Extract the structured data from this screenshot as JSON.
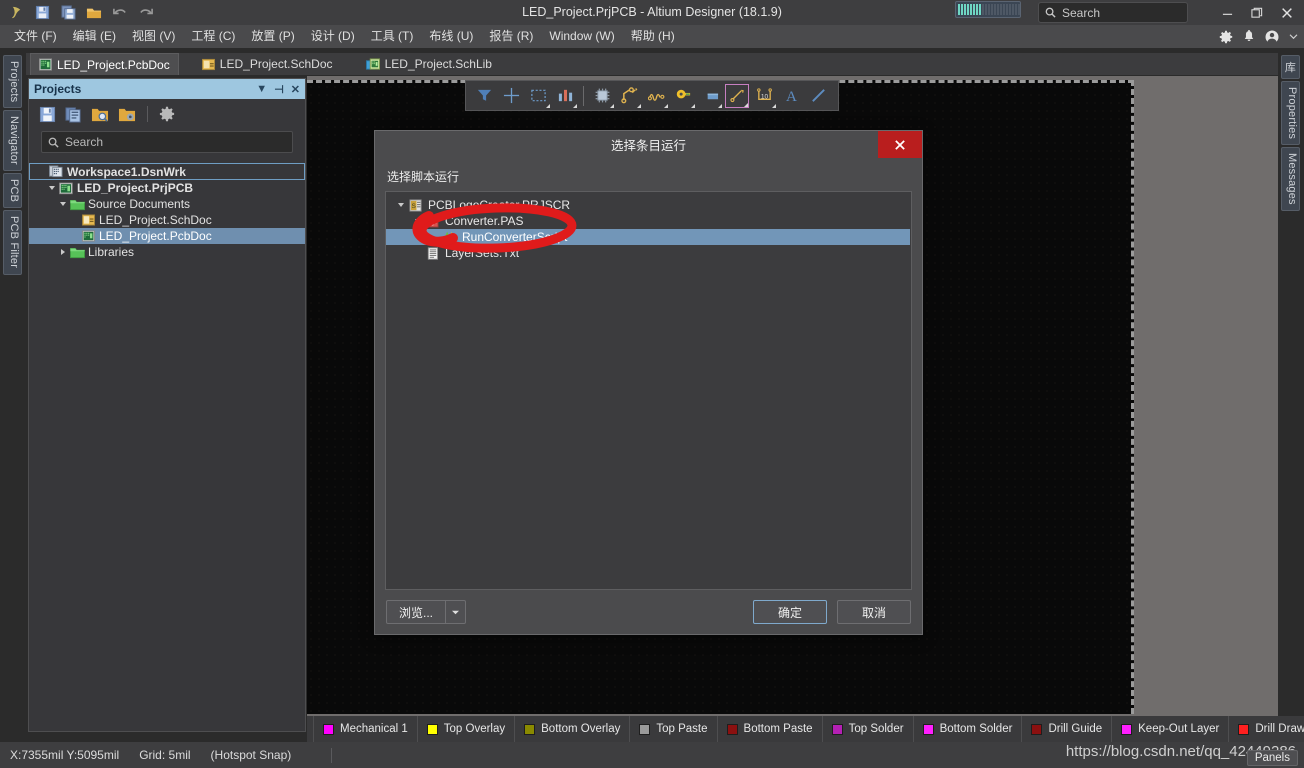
{
  "window": {
    "title": "LED_Project.PrjPCB - Altium Designer (18.1.9)",
    "minimize": "–",
    "restore": "❐",
    "close": "✕"
  },
  "quick_access": [
    {
      "name": "altium-logo-icon",
      "label": "A"
    },
    {
      "name": "save-icon",
      "label": "Save"
    },
    {
      "name": "save-all-icon",
      "label": "Save All"
    },
    {
      "name": "open-folder-icon",
      "label": "Open"
    },
    {
      "name": "undo-icon",
      "label": "Undo"
    },
    {
      "name": "redo-icon",
      "label": "Redo"
    }
  ],
  "level_widget": {
    "name": "license-level-indicator",
    "filled": 8,
    "total": 22
  },
  "search": {
    "placeholder": "Search",
    "value": "Search",
    "icon": "search-icon"
  },
  "menu": [
    {
      "label": "文件 (F)"
    },
    {
      "label": "编辑 (E)"
    },
    {
      "label": "视图 (V)"
    },
    {
      "label": "工程 (C)"
    },
    {
      "label": "放置 (P)"
    },
    {
      "label": "设计 (D)"
    },
    {
      "label": "工具 (T)"
    },
    {
      "label": "布线 (U)"
    },
    {
      "label": "报告 (R)"
    },
    {
      "label": "Window (W)"
    },
    {
      "label": "帮助 (H)"
    }
  ],
  "menu_right_icons": [
    {
      "name": "gear-icon"
    },
    {
      "name": "bell-icon"
    },
    {
      "name": "user-account-icon"
    },
    {
      "name": "chevron-down-icon"
    }
  ],
  "doc_tabs": [
    {
      "label": "LED_Project.PcbDoc",
      "icon": "pcb-document-icon",
      "active": true
    },
    {
      "label": "LED_Project.SchDoc",
      "icon": "schematic-document-icon",
      "active": false
    },
    {
      "label": "LED_Project.SchLib",
      "icon": "schematic-library-icon",
      "active": false
    }
  ],
  "left_rail": [
    {
      "label": "Projects",
      "active": true
    },
    {
      "label": "Navigator",
      "active": false
    },
    {
      "label": "PCB",
      "active": false
    },
    {
      "label": "PCB Filter",
      "active": false
    }
  ],
  "right_rail": [
    {
      "label": "库",
      "active": false
    },
    {
      "label": "Properties",
      "active": false
    },
    {
      "label": "Messages",
      "active": false
    }
  ],
  "projects_panel": {
    "title": "Projects",
    "header_icons": [
      {
        "name": "filter-icon",
        "glyph": "▼"
      },
      {
        "name": "dock-pin-icon",
        "glyph": "⊣"
      },
      {
        "name": "close-panel-icon",
        "glyph": "✕"
      }
    ],
    "toolbar_icons": [
      {
        "name": "save-project-icon"
      },
      {
        "name": "copy-project-icon"
      },
      {
        "name": "search-folder-icon"
      },
      {
        "name": "folder-options-icon"
      },
      {
        "name": "project-settings-gear-icon"
      }
    ],
    "search": {
      "placeholder": "Search",
      "value": "Search",
      "icon": "search-icon"
    },
    "tree": [
      {
        "label": "Workspace1.DsnWrk",
        "indent": 0,
        "twisty": "none",
        "icon": "workspace-icon",
        "state": "outlined",
        "bold": true
      },
      {
        "label": "LED_Project.PrjPCB",
        "indent": 1,
        "twisty": "open",
        "icon": "project-icon",
        "state": "none",
        "bold": true
      },
      {
        "label": "Source Documents",
        "indent": 2,
        "twisty": "open",
        "icon": "folder-icon",
        "state": "none",
        "bold": false
      },
      {
        "label": "LED_Project.SchDoc",
        "indent": 3,
        "twisty": "none",
        "icon": "schematic-document-icon",
        "state": "none",
        "bold": false
      },
      {
        "label": "LED_Project.PcbDoc",
        "indent": 3,
        "twisty": "none",
        "icon": "pcb-document-icon",
        "state": "selected",
        "bold": false
      },
      {
        "label": "Libraries",
        "indent": 2,
        "twisty": "closed",
        "icon": "folder-icon",
        "state": "none",
        "bold": false
      }
    ]
  },
  "float_toolbar": [
    {
      "name": "filter-funnel-icon",
      "dropdown": false,
      "boxed": false
    },
    {
      "name": "crosshair-place-icon",
      "dropdown": false,
      "boxed": false
    },
    {
      "name": "select-area-icon",
      "dropdown": true,
      "boxed": false
    },
    {
      "name": "component-chart-icon",
      "dropdown": true,
      "boxed": false
    },
    {
      "name": "place-component-icon",
      "dropdown": true,
      "boxed": false
    },
    {
      "name": "route-track-icon",
      "dropdown": true,
      "boxed": false
    },
    {
      "name": "interactive-length-tuning-icon",
      "dropdown": true,
      "boxed": false
    },
    {
      "name": "place-via-pad-icon",
      "dropdown": true,
      "boxed": false
    },
    {
      "name": "place-polygon-fill-icon",
      "dropdown": true,
      "boxed": false
    },
    {
      "name": "place-line-dimension-icon",
      "dropdown": true,
      "boxed": true
    },
    {
      "name": "place-dimension-icon",
      "dropdown": true,
      "boxed": false
    },
    {
      "name": "place-string-icon",
      "dropdown": false,
      "boxed": false
    },
    {
      "name": "place-line-icon",
      "dropdown": false,
      "boxed": false
    }
  ],
  "dialog": {
    "title": "选择条目运行",
    "close_glyph": "✕",
    "body_label": "选择脚本运行",
    "tree": [
      {
        "label": "PCBLogoCreator.PRJSCR",
        "indent": 0,
        "twisty": "open",
        "icon": "script-project-icon",
        "selected": false,
        "obscured": false
      },
      {
        "label": "Converter.PAS",
        "indent": 1,
        "twisty": "open",
        "icon": "script-file-icon",
        "selected": false,
        "obscured": true
      },
      {
        "label": "RunConverterScript",
        "indent": 2,
        "twisty": "none",
        "icon": "script-procedure-icon",
        "selected": true,
        "obscured": false
      },
      {
        "label": "LayerSets.Txt",
        "indent": 1,
        "twisty": "none",
        "icon": "text-file-icon",
        "selected": false,
        "obscured": true
      }
    ],
    "browse_label": "浏览...",
    "browse_arrow": "▼",
    "ok_label": "确定",
    "cancel_label": "取消"
  },
  "annotation": {
    "name": "red-highlight-circle",
    "color": "#e01b1b",
    "target": "RunConverterScript"
  },
  "layer_bar": [
    {
      "label": "Mechanical 1",
      "color": "#ff00ff"
    },
    {
      "label": "Top Overlay",
      "color": "#ffff00"
    },
    {
      "label": "Bottom Overlay",
      "color": "#8a8a00"
    },
    {
      "label": "Top Paste",
      "color": "#9a9a9a"
    },
    {
      "label": "Bottom Paste",
      "color": "#8b1010"
    },
    {
      "label": "Top Solder",
      "color": "#b420b4"
    },
    {
      "label": "Bottom Solder",
      "color": "#ff1fff"
    },
    {
      "label": "Drill Guide",
      "color": "#8b1010"
    },
    {
      "label": "Keep-Out Layer",
      "color": "#ff1fff"
    },
    {
      "label": "Drill Drawing",
      "color": "#ff2020"
    },
    {
      "label": "",
      "color": "#b8b8b8"
    }
  ],
  "status_bar": {
    "coordinates": "X:7355mil Y:5095mil",
    "grid": "Grid: 5mil",
    "snap": "(Hotspot Snap)",
    "watermark": "https://blog.csdn.net/qq_42449286",
    "panels_label": "Panels"
  }
}
